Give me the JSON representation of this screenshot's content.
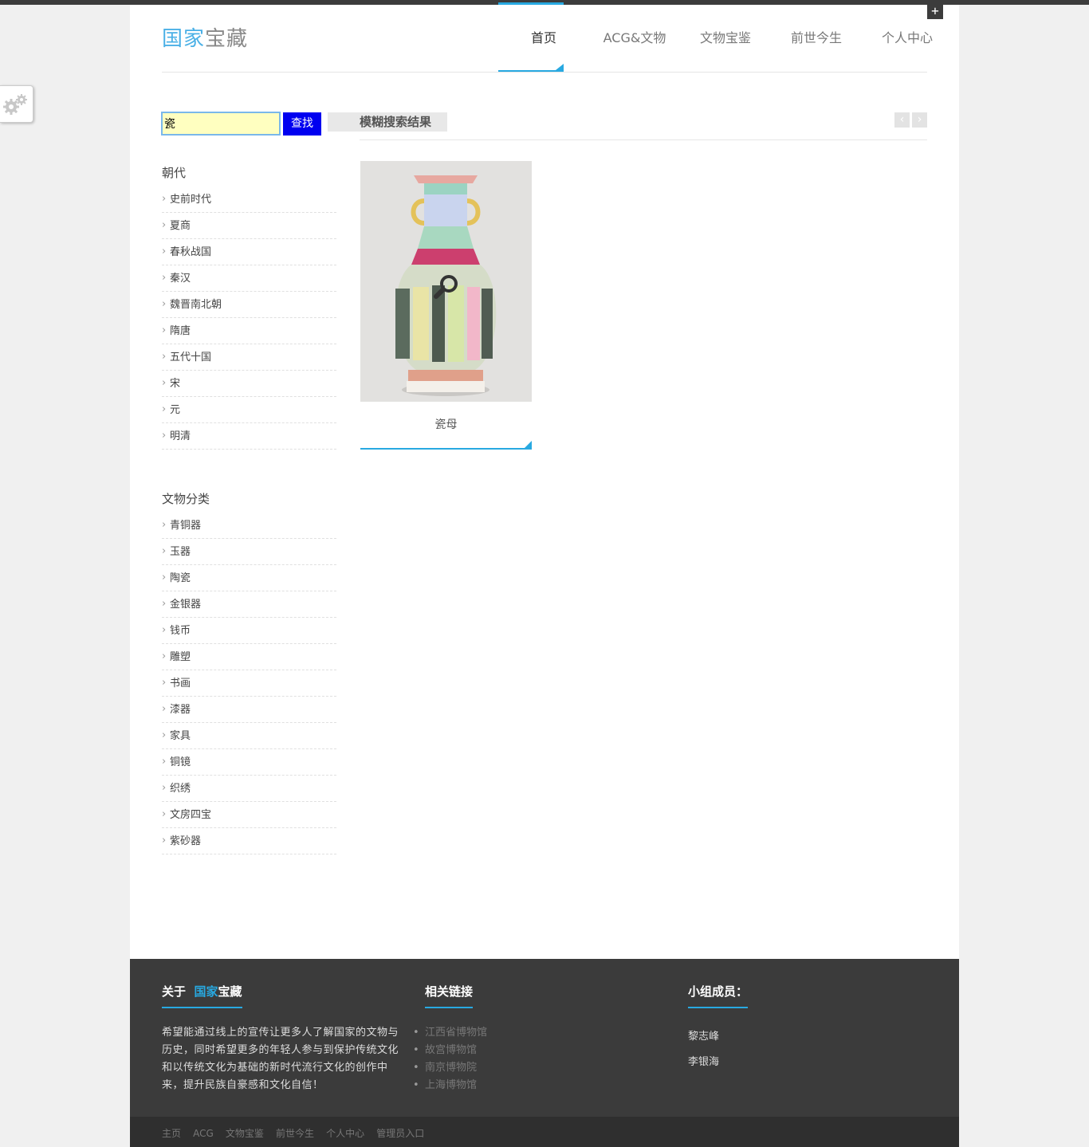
{
  "header": {
    "logo_part1": "国家",
    "logo_part2": "宝藏",
    "plus_label": "+",
    "nav": [
      "首页",
      "ACG&文物",
      "文物宝鉴",
      "前世今生",
      "个人中心"
    ]
  },
  "search": {
    "value": "瓷",
    "button_label": "查找",
    "result_tab": "模糊搜索结果",
    "prev": "‹",
    "next": "›"
  },
  "sidebar": {
    "dynasty_title": "朝代",
    "dynasties": [
      "史前时代",
      "夏商",
      "春秋战国",
      "秦汉",
      "魏晋南北朝",
      "隋唐",
      "五代十国",
      "宋",
      "元",
      "明清"
    ],
    "category_title": "文物分类",
    "categories": [
      "青铜器",
      "玉器",
      "陶瓷",
      "金银器",
      "钱币",
      "雕塑",
      "书画",
      "漆器",
      "家具",
      "铜镜",
      "织绣",
      "文房四宝",
      "紫砂器"
    ]
  },
  "results": [
    {
      "name": "瓷母",
      "icon": "magnifier-icon"
    }
  ],
  "footer": {
    "about_prefix": "关于",
    "about_blue": "国家",
    "about_white": "宝藏",
    "about_text": "希望能通过线上的宣传让更多人了解国家的文物与历史，同时希望更多的年轻人参与到保护传统文化和以传统文化为基础的新时代流行文化的创作中来，提升民族自豪感和文化自信！",
    "links_title": "相关链接",
    "links": [
      "江西省博物馆",
      "故宫博物馆",
      "南京博物院",
      "上海博物馆"
    ],
    "members_title": "小组成员：",
    "members": [
      "黎志峰",
      "李银海"
    ]
  },
  "bottom_links": [
    "主页",
    "ACG",
    "文物宝鉴",
    "前世今生",
    "个人中心",
    "管理员入口"
  ],
  "colors": {
    "accent": "#28a9e1",
    "search_button": "#0000f0",
    "search_input_bg": "#ffffc0",
    "footer_bg": "#3b3b3b"
  }
}
